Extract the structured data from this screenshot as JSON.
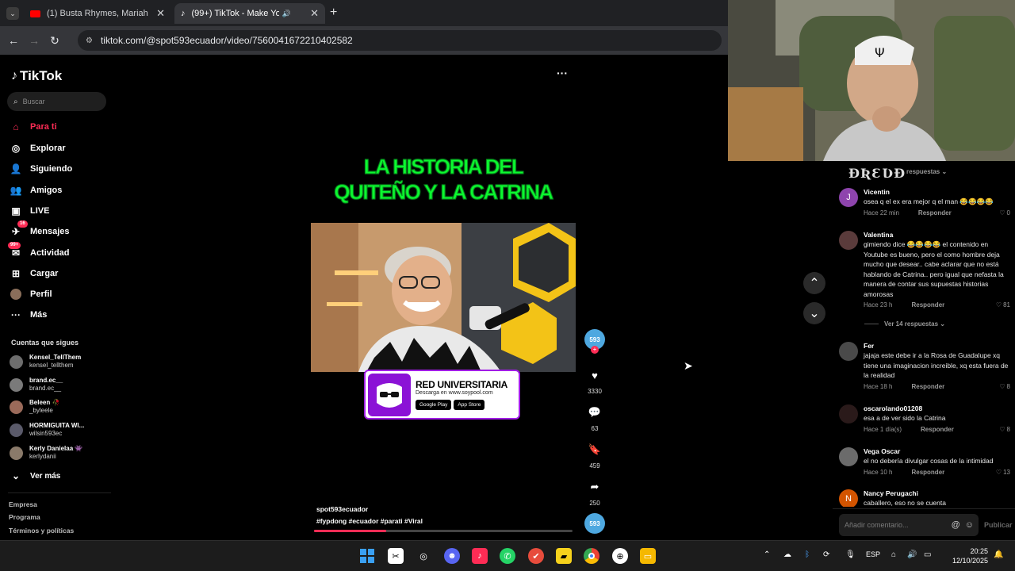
{
  "browser": {
    "tabs": [
      {
        "title": "(1) Busta Rhymes, Mariah Carey",
        "active": false
      },
      {
        "title": "(99+) TikTok - Make Your Da",
        "active": true
      }
    ],
    "url": "tiktok.com/@spot593ecuador/video/7560041672210402582"
  },
  "sidebar": {
    "logo": "TikTok",
    "search_placeholder": "Buscar",
    "nav": [
      {
        "label": "Para ti",
        "icon": "home-icon",
        "active": true
      },
      {
        "label": "Explorar",
        "icon": "compass-icon"
      },
      {
        "label": "Siguiendo",
        "icon": "following-icon"
      },
      {
        "label": "Amigos",
        "icon": "friends-icon"
      },
      {
        "label": "LIVE",
        "icon": "live-icon"
      },
      {
        "label": "Mensajes",
        "icon": "messages-icon",
        "badge": "16"
      },
      {
        "label": "Actividad",
        "icon": "activity-icon",
        "badge": "99+"
      },
      {
        "label": "Cargar",
        "icon": "upload-icon"
      },
      {
        "label": "Perfil",
        "icon": "profile-icon"
      },
      {
        "label": "Más",
        "icon": "more-icon"
      }
    ],
    "following_title": "Cuentas que sigues",
    "following": [
      {
        "name": "Kensel_TellThem",
        "handle": "kensel_tellthem"
      },
      {
        "name": "brand.ec__",
        "handle": "brand.ec__"
      },
      {
        "name": "Beleen 🥀",
        "handle": "_byleele"
      },
      {
        "name": "HORMIGUITA WI...",
        "handle": "wilsin593ec"
      },
      {
        "name": "Kerly Danielaa 👾",
        "handle": "kerlydanii"
      }
    ],
    "see_more": "Ver más",
    "footer": [
      "Empresa",
      "Programa",
      "Términos y políticas"
    ]
  },
  "video": {
    "headline_line1": "LA HISTORIA DEL",
    "headline_line2": "QUITEÑO Y LA CATRINA",
    "promo_title": "RED UNIVERSITARIA",
    "promo_sub": "Descarga en www.soypool.com",
    "promo_google": "Google Play",
    "promo_apple": "App Store",
    "author": "spot593ecuador",
    "hashtags": "#fypdong  #ecuador  #parati  #Viral",
    "progress": 0.28,
    "more_label": "···",
    "likes": "3330",
    "comments": "63",
    "saves": "459",
    "shares": "250",
    "avatar_label": "593"
  },
  "comments": {
    "header": "respuestas",
    "items": [
      {
        "name": "Vicentin",
        "text": "osea q el ex era mejor q el man 😂😂😂😂",
        "time": "Hace 22 min",
        "reply": "Responder",
        "likes": "0",
        "avatar": "J",
        "color": "#8e44ad"
      },
      {
        "name": "Valentina",
        "text": "gimiendo dice 😂😂😂😂 el contenido en Youtube es bueno, pero el como hombre deja mucho que desear.. cabe aclarar que no está hablando de Catrina.. pero igual que nefasta la manera de contar sus supuestas historias amorosas",
        "time": "Hace 23 h",
        "reply": "Responder",
        "likes": "81",
        "avatar": "",
        "color": "#5a3b3b"
      },
      {
        "name": "Fer",
        "text": "jajaja este debe ir a la Rosa de Guadalupe xq tiene una imaginacion increible, xq esta fuera de la realidad",
        "time": "Hace 18 h",
        "reply": "Responder",
        "likes": "8",
        "avatar": "",
        "color": "#4a4a4a"
      },
      {
        "name": "oscarolando01208",
        "text": "esa a de ver sido la Catrina",
        "time": "Hace 1 día(s)",
        "reply": "Responder",
        "likes": "8",
        "avatar": "",
        "color": "#2a1a1a"
      },
      {
        "name": "Vega Oscar",
        "text": "el no debería divulgar cosas de la intimidad",
        "time": "Hace 10 h",
        "reply": "Responder",
        "likes": "13",
        "avatar": "",
        "color": "#6b6b6b"
      },
      {
        "name": "Nancy Perugachi",
        "text": "caballero, eso no se cuenta",
        "time": "",
        "reply": "",
        "likes": "",
        "avatar": "N",
        "color": "#d35400"
      }
    ],
    "replies_toggle": "Ver 14 respuestas",
    "input_placeholder": "Añadir comentario...",
    "publish": "Publicar"
  },
  "taskbar": {
    "lang": "ESP",
    "time": "20:25",
    "date": "12/10/2025"
  }
}
